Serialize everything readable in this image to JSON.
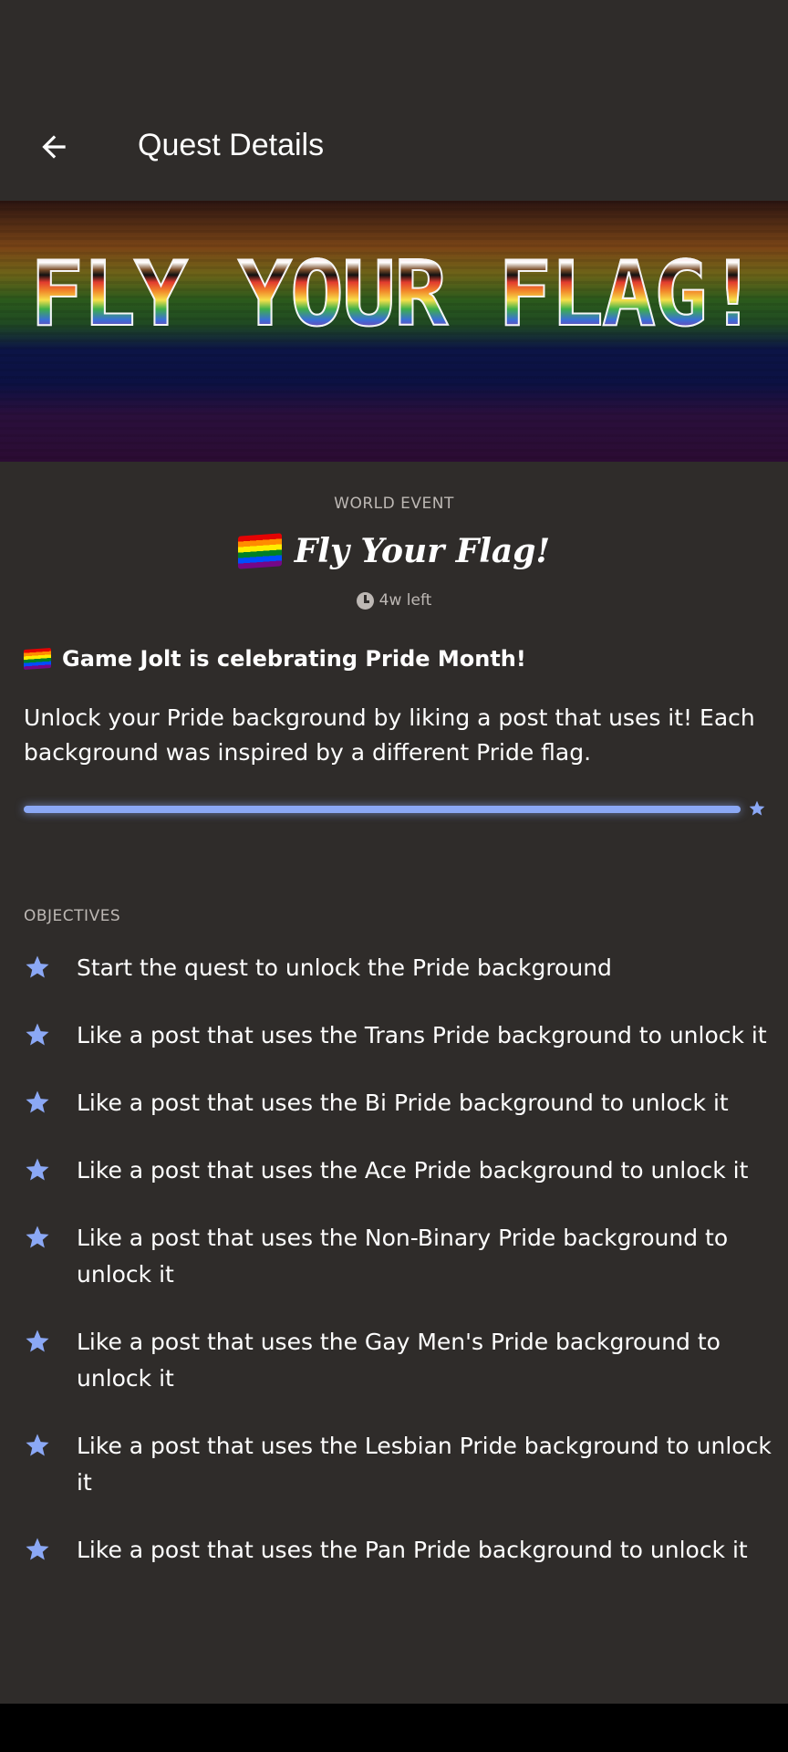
{
  "header": {
    "title": "Quest Details",
    "back_icon": "arrow-left-icon"
  },
  "banner": {
    "text": "FLY YOUR FLAG!"
  },
  "event": {
    "type_label": "WORLD EVENT",
    "title": "Fly Your Flag!",
    "time_left": "4w left",
    "headline": "Game Jolt is celebrating Pride Month!",
    "description": "Unlock your Pride background by liking a post that uses it! Each background was inspired by a different Pride flag."
  },
  "progress": {
    "fraction": 1.0,
    "color": "#8ba8f5"
  },
  "objectives": {
    "label": "OBJECTIVES",
    "items": [
      "Start the quest to unlock the Pride background",
      "Like a post that uses the Trans Pride background to unlock it",
      "Like a post that uses the Bi Pride background to unlock it",
      "Like a post that uses the Ace Pride background to unlock it",
      "Like a post that uses the Non-Binary Pride background to unlock it",
      "Like a post that uses the Gay Men's Pride background to unlock it",
      "Like a post that uses the Lesbian Pride background to unlock it",
      "Like a post that uses the Pan Pride background to unlock it"
    ]
  },
  "colors": {
    "background": "#2f2c2a",
    "accent_star": "#8ba8f5",
    "muted_text": "#bdb8b4"
  }
}
